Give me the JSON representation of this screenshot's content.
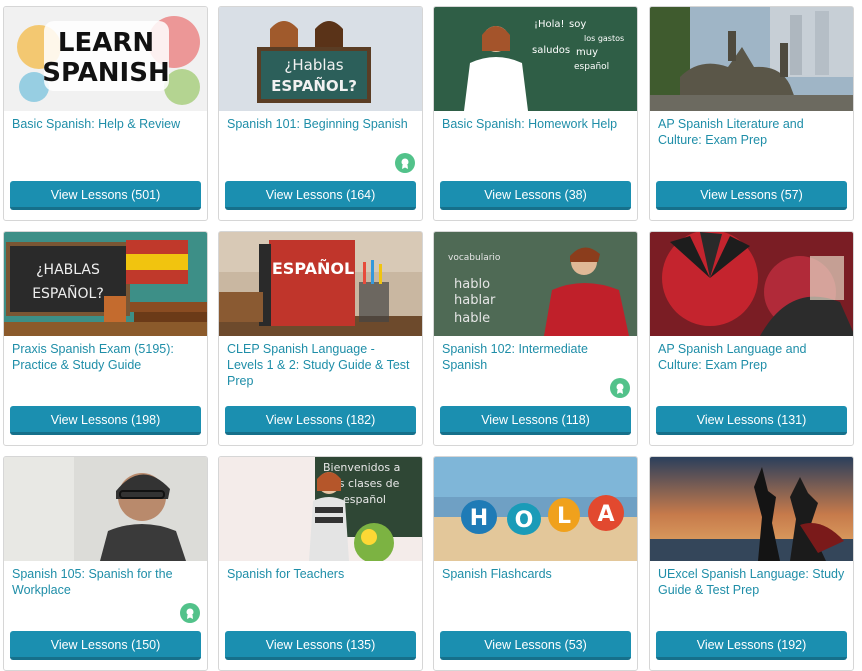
{
  "courses": [
    {
      "title": "Basic Spanish: Help & Review",
      "button": "View Lessons (501)",
      "thumb_text": [
        "LEARN",
        "SPANISH"
      ]
    },
    {
      "title": "Spanish 101: Beginning Spanish",
      "button": "View Lessons (164)",
      "thumb_text": [
        "¿Hablas",
        "ESPAÑOL?"
      ],
      "badge": "badge-icon"
    },
    {
      "title": "Basic Spanish: Homework Help",
      "button": "View Lessons (38)",
      "thumb_text": [
        "¡Hola!",
        "soy",
        "los gastos",
        "saludos",
        "muy",
        "español"
      ]
    },
    {
      "title": "AP Spanish Literature and Culture: Exam Prep",
      "button": "View Lessons (57)"
    },
    {
      "title": "Praxis Spanish Exam (5195): Practice & Study Guide",
      "button": "View Lessons (198)",
      "thumb_text": [
        "¿HABLAS",
        "ESPAÑOL?"
      ]
    },
    {
      "title": "CLEP Spanish Language - Levels 1 & 2: Study Guide & Test Prep",
      "button": "View Lessons (182)",
      "thumb_text": [
        "ESPAÑOL"
      ]
    },
    {
      "title": "Spanish 102: Intermediate Spanish",
      "button": "View Lessons (118)",
      "thumb_text": [
        "vocabulario",
        "hablo",
        "hablar",
        "hable"
      ],
      "badge": "badge-icon"
    },
    {
      "title": "AP Spanish Language and Culture: Exam Prep",
      "button": "View Lessons (131)"
    },
    {
      "title": "Spanish 105: Spanish for the Workplace",
      "button": "View Lessons (150)",
      "badge": "badge-icon"
    },
    {
      "title": "Spanish for Teachers",
      "button": "View Lessons (135)",
      "thumb_text": [
        "Bienvenidos a",
        "las clases de",
        "español"
      ]
    },
    {
      "title": "Spanish Flashcards",
      "button": "View Lessons (53)",
      "thumb_text": [
        "H",
        "O",
        "L",
        "A"
      ]
    },
    {
      "title": "UExcel Spanish Language: Study Guide & Test Prep",
      "button": "View Lessons (192)"
    }
  ],
  "colors": {
    "title": "#1f8ea8",
    "button": "#1b8fb0",
    "badge": "#52c28a"
  }
}
